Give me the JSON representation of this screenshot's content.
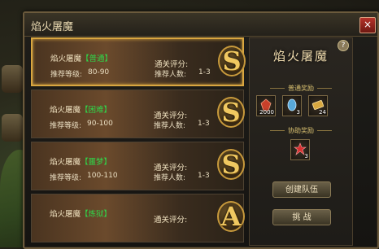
{
  "window": {
    "title": "焰火屠魔",
    "close_label": "×"
  },
  "dungeons": [
    {
      "name": "焰火屠魔",
      "difficulty": "【普通】",
      "difficulty_color": "#2fd84a",
      "level_label": "推荐等级:",
      "level": "80-90",
      "clear_label": "通关评分:",
      "people_label": "推荐人数:",
      "people": "1-3",
      "rank": "S"
    },
    {
      "name": "焰火屠魔",
      "difficulty": "【困难】",
      "difficulty_color": "#2fd84a",
      "level_label": "推荐等级:",
      "level": "90-100",
      "clear_label": "通关评分:",
      "people_label": "推荐人数:",
      "people": "1-3",
      "rank": "S"
    },
    {
      "name": "焰火屠魔",
      "difficulty": "【噩梦】",
      "difficulty_color": "#2fd84a",
      "level_label": "推荐等级:",
      "level": "100-110",
      "clear_label": "通关评分:",
      "people_label": "推荐人数:",
      "people": "1-3",
      "rank": "S"
    },
    {
      "name": "焰火屠魔",
      "difficulty": "【炼狱】",
      "difficulty_color": "#2fd84a",
      "level_label": "推荐等级:",
      "level": "",
      "clear_label": "通关评分:",
      "people_label": "",
      "people": "",
      "rank": "A"
    }
  ],
  "panel": {
    "title": "焰火屠魔",
    "help_label": "?",
    "normal_rewards_label": "普通奖励",
    "normal_rewards": [
      {
        "icon": "red-gem-icon",
        "count": "2000",
        "color": "#c8402a"
      },
      {
        "icon": "blue-crystal-icon",
        "count": "3",
        "color": "#58a8d8"
      },
      {
        "icon": "gold-scroll-icon",
        "count": "24",
        "color": "#d8a840"
      }
    ],
    "assist_rewards_label": "协助奖励",
    "assist_rewards": [
      {
        "icon": "red-star-icon",
        "count": "3",
        "color": "#d83030"
      }
    ],
    "create_team_label": "创建队伍",
    "challenge_label": "挑 战"
  }
}
